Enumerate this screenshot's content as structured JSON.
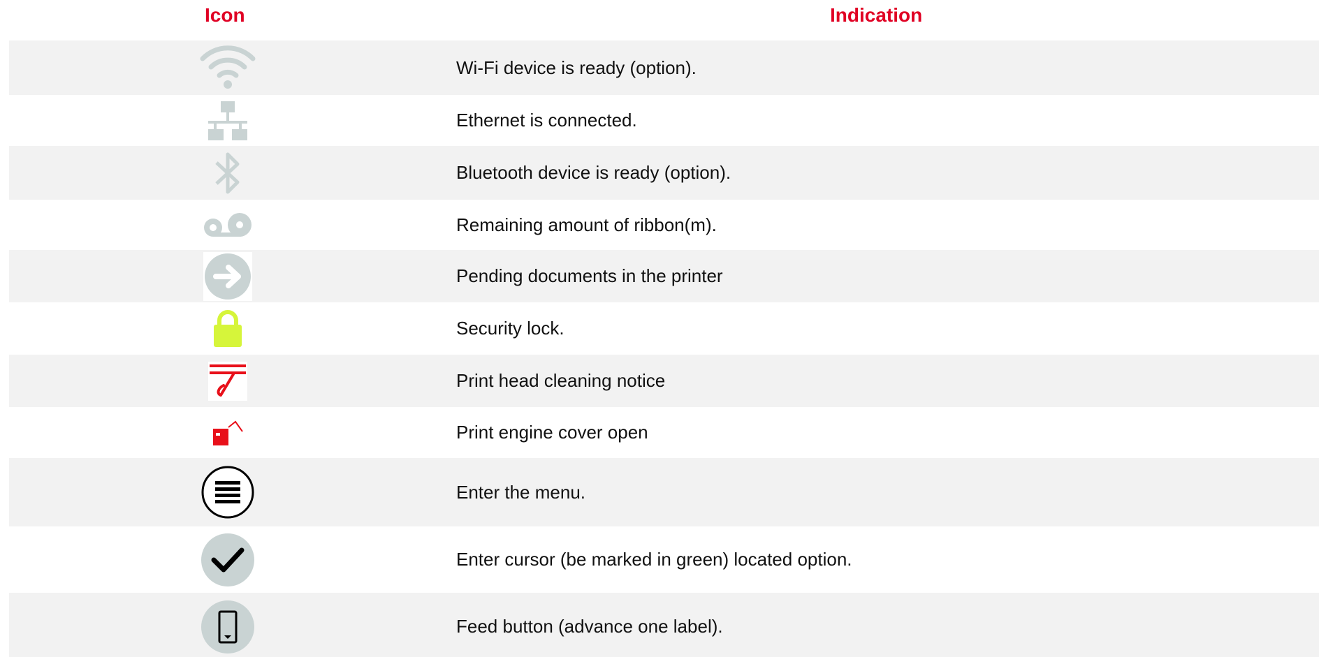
{
  "header": {
    "icon_label": "Icon",
    "indication_label": "Indication"
  },
  "colors": {
    "header_red": "#e00024",
    "row_shade": "#f2f2f2",
    "icon_gray": "#c9d3d3",
    "lock_yellow": "#d6f53a",
    "alert_red": "#e8101a"
  },
  "rows": [
    {
      "icon": "wifi-icon",
      "text": "Wi-Fi device is ready (option)."
    },
    {
      "icon": "ethernet-icon",
      "text": "Ethernet is connected."
    },
    {
      "icon": "bluetooth-icon",
      "text": "Bluetooth device is ready (option)."
    },
    {
      "icon": "ribbon-icon",
      "text": "Remaining amount of ribbon(m)."
    },
    {
      "icon": "pending-arrow-icon",
      "text": "Pending documents in the printer"
    },
    {
      "icon": "lock-icon",
      "text": "Security lock."
    },
    {
      "icon": "print-head-cleaning-icon",
      "text": "Print head cleaning notice"
    },
    {
      "icon": "cover-open-icon",
      "text": "Print engine cover open"
    },
    {
      "icon": "menu-icon",
      "text": "Enter the menu."
    },
    {
      "icon": "check-icon",
      "text": "Enter cursor (be marked in green) located option."
    },
    {
      "icon": "feed-icon",
      "text": "Feed button (advance one label)."
    }
  ]
}
